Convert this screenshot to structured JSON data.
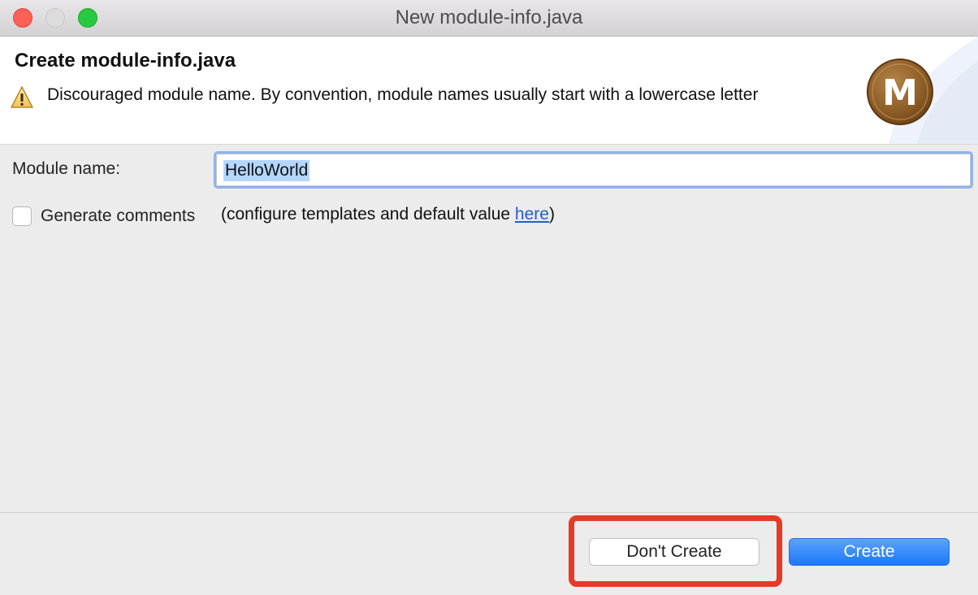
{
  "window": {
    "title": "New module-info.java"
  },
  "banner": {
    "title": "Create module-info.java",
    "message": "Discouraged module name. By convention, module names usually start with a lowercase letter",
    "logo_letter": "M",
    "warning_icon": "warning-triangle-icon"
  },
  "form": {
    "module_name_label": "Module name:",
    "module_name_value": "HelloWorld",
    "generate_comments_label": "Generate comments",
    "generate_comments_checked": false,
    "configure_prefix": "(configure templates and default value ",
    "configure_link": "here",
    "configure_suffix": ")"
  },
  "buttons": {
    "dont_create": "Don't Create",
    "create": "Create"
  },
  "colors": {
    "accent_blue": "#1c78f7",
    "highlight_red": "#e43b26",
    "logo_brown": "#8a5a24",
    "link_blue": "#1f5fcf"
  }
}
